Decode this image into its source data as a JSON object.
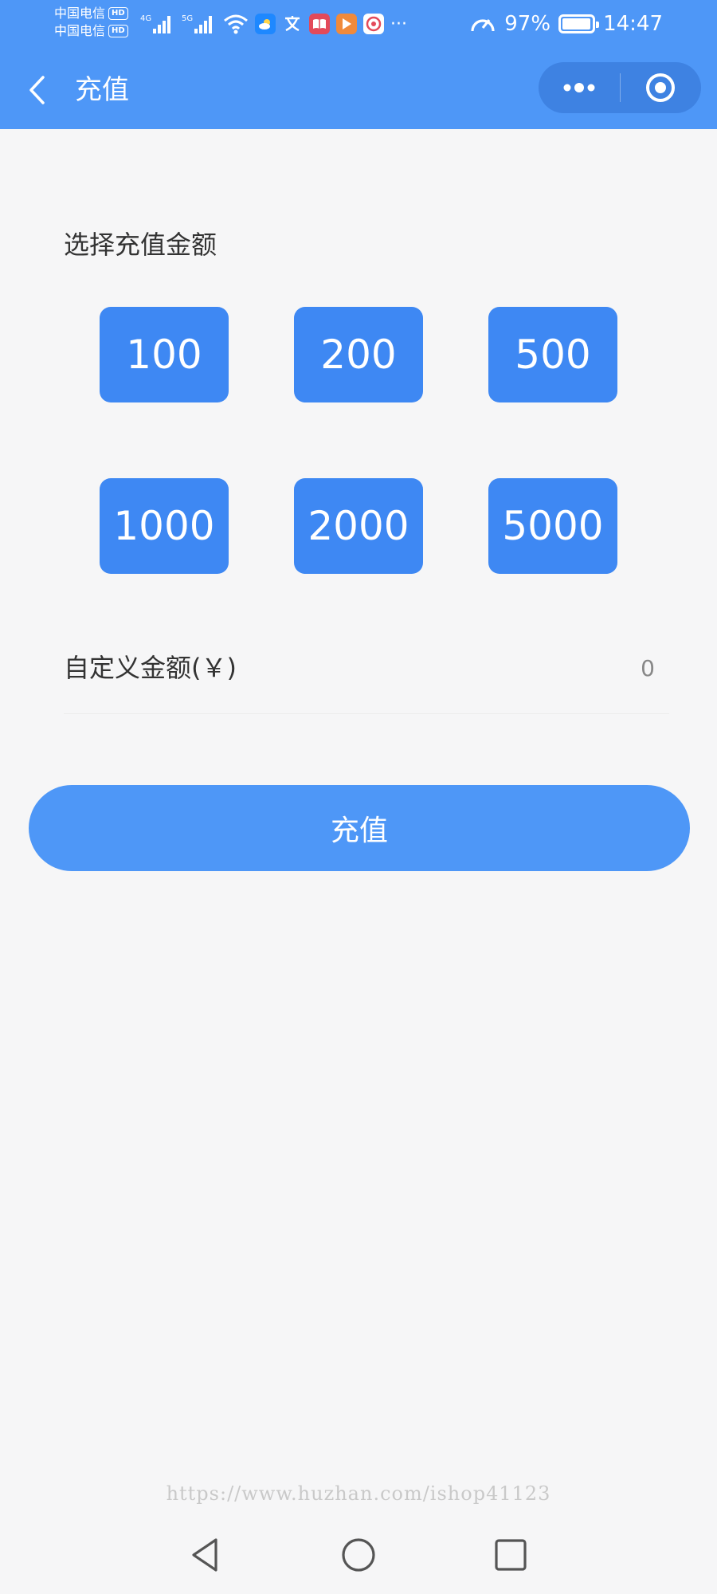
{
  "status_bar": {
    "carrier_1": "中国电信",
    "carrier_2": "中国电信",
    "hd_label": "HD",
    "net_4g": "4G",
    "net_5g": "5G",
    "more_dots": "···",
    "battery_percent": "97%",
    "battery_level": 0.97,
    "time": "14:47"
  },
  "nav": {
    "title": "充值",
    "back_icon": "chevron-left-icon",
    "more_icon": "more-dots-icon",
    "close_icon": "target-circle-icon"
  },
  "recharge": {
    "section_title": "选择充值金额",
    "amounts": [
      "100",
      "200",
      "500",
      "1000",
      "2000",
      "5000"
    ],
    "custom_label": "自定义金额(￥)",
    "custom_value": "",
    "custom_placeholder": "0",
    "submit_label": "充值"
  },
  "watermark": "https://www.huzhan.com/ishop41123",
  "colors": {
    "brand_blue": "#4e97f7",
    "amount_button": "#3e88f3",
    "background": "#f6f6f7"
  }
}
